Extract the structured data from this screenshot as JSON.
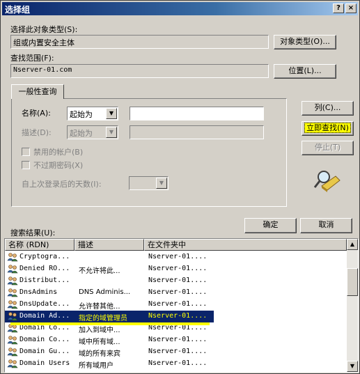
{
  "window": {
    "title": "选择组",
    "help_btn": "?",
    "close_btn": "×"
  },
  "object_type": {
    "label": "选择此对象类型(S):",
    "value": "组或内置安全主体",
    "button": "对象类型(O)..."
  },
  "location": {
    "label": "查找范围(F):",
    "value": "Nserver-01.com",
    "button": "位置(L)..."
  },
  "query": {
    "tab": "一般性查询",
    "name_label": "名称(A):",
    "name_op": "起始为",
    "name_value": "",
    "desc_label": "描述(D):",
    "desc_op": "起始为",
    "desc_value": "",
    "disabled_accounts": "禁用的帐户(B)",
    "no_expire_pwd": "不过期密码(X)",
    "days_label": "自上次登录后的天数(I):",
    "days_value": ""
  },
  "buttons": {
    "columns": "列(C)...",
    "find_now": "立即查找(N)",
    "stop": "停止(T)",
    "ok": "确定",
    "cancel": "取消"
  },
  "results": {
    "label": "搜索结果(U):",
    "columns": [
      "名称 (RDN)",
      "描述",
      "在文件夹中"
    ],
    "rows": [
      [
        "Cryptogra...",
        "",
        "Nserver-01...."
      ],
      [
        "Denied RO...",
        "不允许将此...",
        "Nserver-01...."
      ],
      [
        "Distribut...",
        "",
        "Nserver-01...."
      ],
      [
        "DnsAdmins",
        "DNS Adminis...",
        "Nserver-01...."
      ],
      [
        "DnsUpdate...",
        "允许替其他...",
        "Nserver-01...."
      ],
      [
        "Domain Ad...",
        "指定的域管理员",
        "Nserver-01...."
      ],
      [
        "Domain Co...",
        "加入到域中...",
        "Nserver-01...."
      ],
      [
        "Domain Co...",
        "域中所有域...",
        "Nserver-01...."
      ],
      [
        "Domain Gu...",
        "域的所有来宾",
        "Nserver-01...."
      ],
      [
        "Domain Users",
        "所有域用户",
        "Nserver-01...."
      ]
    ]
  }
}
